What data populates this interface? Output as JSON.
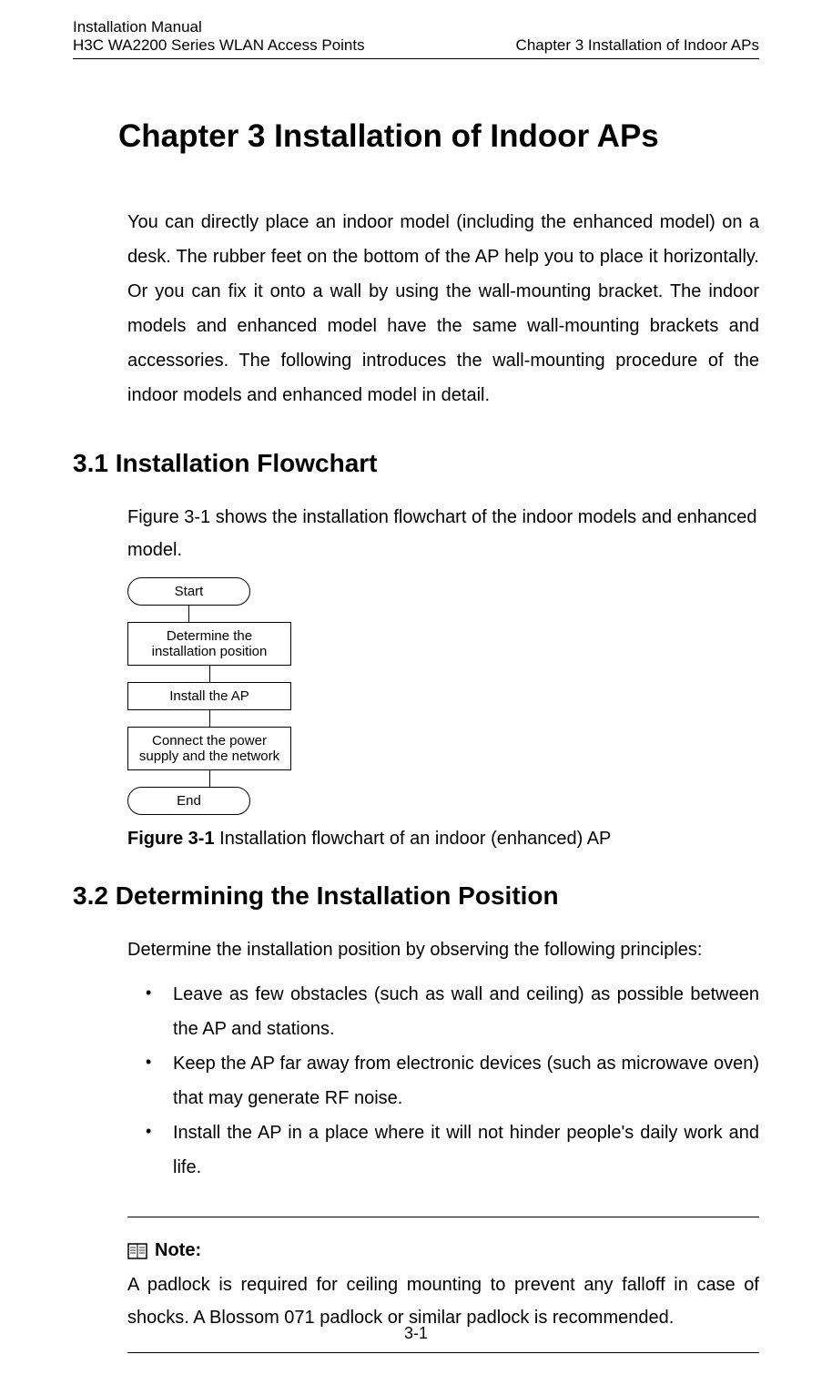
{
  "header": {
    "line1": "Installation Manual",
    "line2": "H3C WA2200 Series WLAN Access Points",
    "right": "Chapter 3  Installation of Indoor APs"
  },
  "chapter_title": "Chapter 3  Installation of Indoor APs",
  "intro": "You can directly place an indoor model (including the enhanced model) on a desk. The rubber feet on the bottom of the AP help you to place it horizontally. Or you can fix it onto a wall by using the wall-mounting bracket. The indoor models and enhanced model have the same wall-mounting brackets and accessories. The following introduces the wall-mounting procedure of the indoor models and enhanced model in detail.",
  "section_3_1": {
    "heading": "3.1  Installation Flowchart",
    "para": "Figure 3-1 shows the installation flowchart of the indoor models and enhanced model.",
    "flowchart": {
      "start": "Start",
      "step1": "Determine the installation position",
      "step2": "Install the AP",
      "step3": "Connect the power supply and the network",
      "end": "End"
    },
    "figure_label": "Figure 3-1",
    "figure_caption": " Installation flowchart of an indoor (enhanced) AP"
  },
  "section_3_2": {
    "heading": "3.2  Determining the Installation Position",
    "para": "Determine the installation position by observing the following principles:",
    "bullets": [
      "Leave as few obstacles (such as wall and ceiling) as possible between the AP and stations.",
      "Keep the AP far away from electronic devices (such as microwave oven) that may generate RF noise.",
      "Install the AP in a place where it will not hinder people's daily work and life."
    ]
  },
  "note": {
    "title": "Note:",
    "text": "A padlock is required for ceiling mounting to prevent any falloff in case of shocks. A Blossom 071 padlock or similar padlock is recommended."
  },
  "page_number": "3-1"
}
